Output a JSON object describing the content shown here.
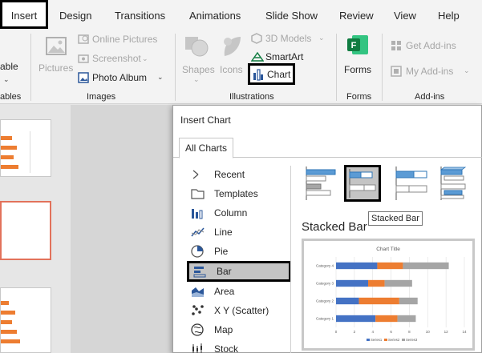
{
  "tabs": [
    "Insert",
    "Design",
    "Transitions",
    "Animations",
    "Slide Show",
    "Review",
    "View",
    "Help"
  ],
  "ribbon": {
    "table_label": "able",
    "tables_group": "ables",
    "pictures": "Pictures",
    "online_pictures": "Online Pictures",
    "screenshot": "Screenshot",
    "photo_album": "Photo Album",
    "images_group": "Images",
    "shapes": "Shapes",
    "icons": "Icons",
    "models_3d": "3D Models",
    "smartart": "SmartArt",
    "chart": "Chart",
    "illustrations_group": "Illustrations",
    "forms": "Forms",
    "forms_group": "Forms",
    "get_addins": "Get Add-ins",
    "my_addins": "My Add-ins",
    "addins_group": "Add-ins"
  },
  "dialog": {
    "title": "Insert Chart",
    "tab": "All Charts",
    "types": [
      "Recent",
      "Templates",
      "Column",
      "Line",
      "Pie",
      "Bar",
      "Area",
      "X Y (Scatter)",
      "Map",
      "Stock"
    ],
    "selected_type": "Bar",
    "tooltip": "Stacked Bar",
    "subtype_title": "Stacked Bar"
  },
  "chart_data": {
    "type": "bar",
    "stacked": true,
    "orientation": "horizontal",
    "title": "Chart Title",
    "categories": [
      "Category 1",
      "Category 2",
      "Category 3",
      "Category 4"
    ],
    "series": [
      {
        "name": "Series1",
        "values": [
          4.3,
          2.5,
          3.5,
          4.5
        ],
        "color": "#4472c4"
      },
      {
        "name": "Series2",
        "values": [
          2.4,
          4.4,
          1.8,
          2.8
        ],
        "color": "#ed7d31"
      },
      {
        "name": "Series3",
        "values": [
          2,
          2,
          3,
          5
        ],
        "color": "#a5a5a5"
      }
    ],
    "xlim": [
      0,
      14
    ],
    "x_ticks": [
      "0",
      "2",
      "4",
      "6",
      "8",
      "10",
      "12",
      "14"
    ],
    "legend": "bottom",
    "grid": true
  },
  "colors": {
    "accent": "#ed7d31",
    "blue": "#4472c4",
    "gray": "#a5a5a5",
    "forms_green": "#107c41"
  }
}
